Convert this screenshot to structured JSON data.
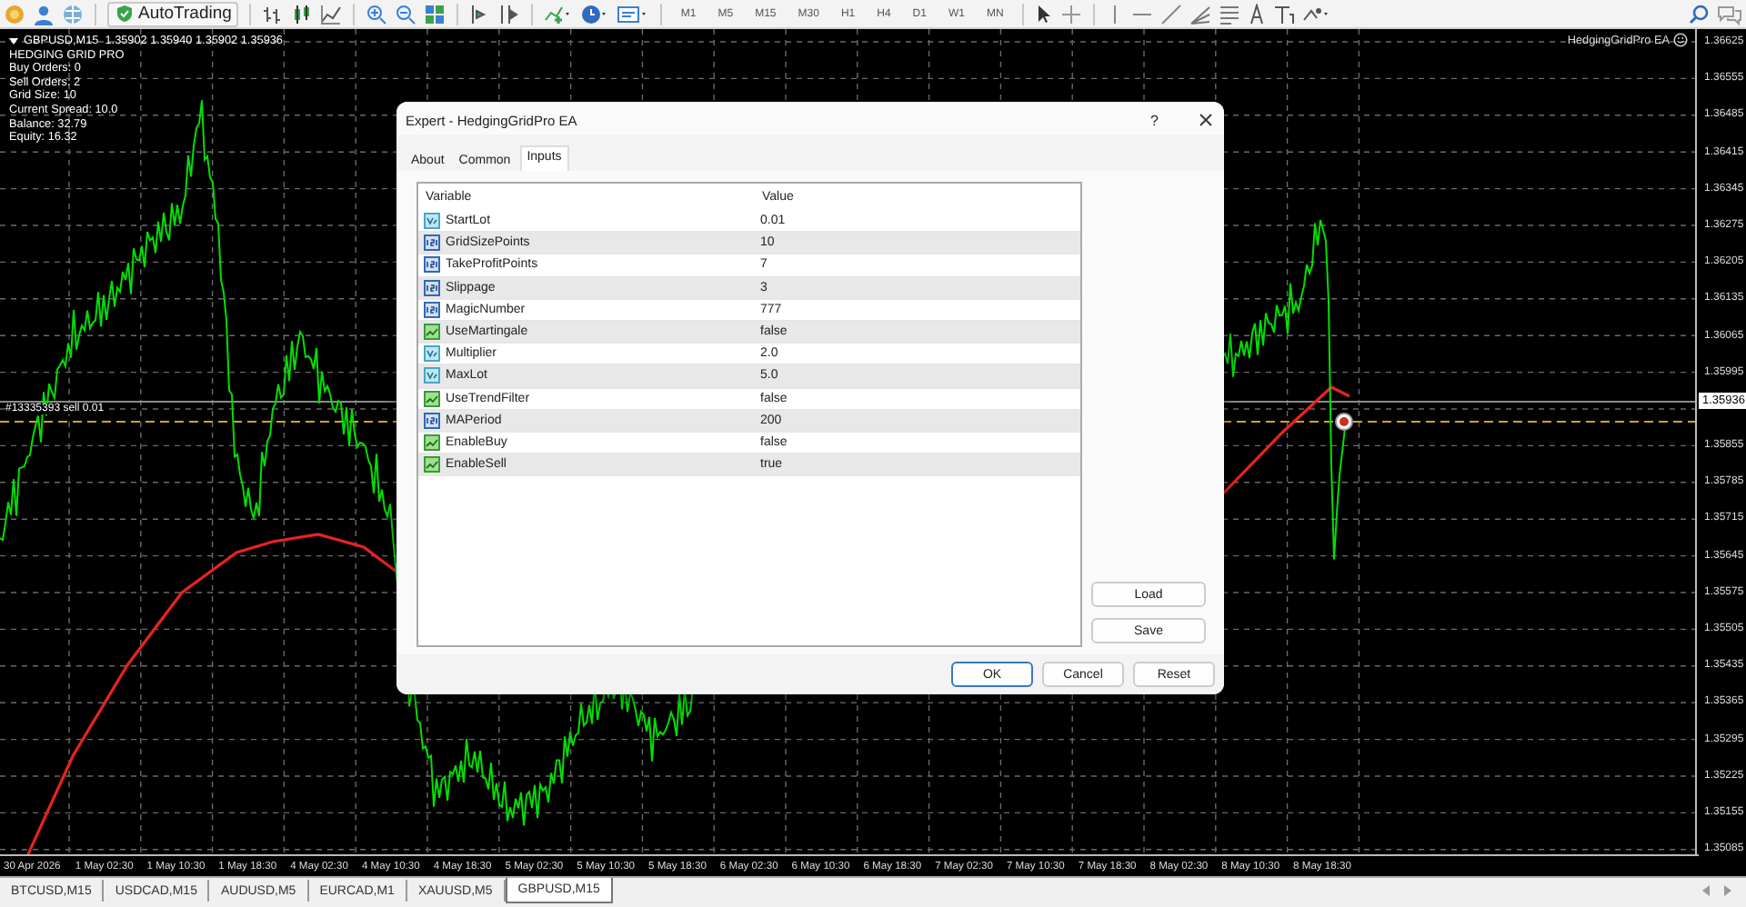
{
  "toolbar": {
    "autotrading": "AutoTrading",
    "timeframes": [
      "M1",
      "M5",
      "M15",
      "M30",
      "H1",
      "H4",
      "D1",
      "W1",
      "MN"
    ]
  },
  "chart": {
    "header": "GBPUSD,M15  1.35902 1.35940 1.35902 1.35936",
    "info_lines": [
      "HEDGING GRID PRO",
      "Buy Orders: 0",
      "Sell Orders: 2",
      "Grid Size: 10",
      "Current Spread: 10.0",
      "Balance: 32.79",
      "Equity: 16.32"
    ],
    "expert_label": "HedgingGridPro EA",
    "order_label": "#13335393 sell 0.01",
    "price_axis": [
      {
        "label": "1.36625",
        "kind": "tick"
      },
      {
        "label": "1.36555",
        "kind": "tick"
      },
      {
        "label": "1.36485",
        "kind": "tick"
      },
      {
        "label": "1.36415",
        "kind": "tick"
      },
      {
        "label": "1.36345",
        "kind": "tick"
      },
      {
        "label": "1.36275",
        "kind": "tick"
      },
      {
        "label": "1.36205",
        "kind": "tick"
      },
      {
        "label": "1.36135",
        "kind": "tick"
      },
      {
        "label": "1.36065",
        "kind": "tick"
      },
      {
        "label": "1.35995",
        "kind": "tick"
      },
      {
        "label": "1.35936",
        "kind": "current"
      },
      {
        "label": "1.35855",
        "kind": "tick"
      },
      {
        "label": "1.35785",
        "kind": "tick"
      },
      {
        "label": "1.35715",
        "kind": "tick"
      },
      {
        "label": "1.35645",
        "kind": "tick"
      },
      {
        "label": "1.35575",
        "kind": "tick"
      },
      {
        "label": "1.35505",
        "kind": "tick"
      },
      {
        "label": "1.35435",
        "kind": "tick"
      },
      {
        "label": "1.35365",
        "kind": "tick"
      },
      {
        "label": "1.35295",
        "kind": "tick"
      },
      {
        "label": "1.35225",
        "kind": "tick"
      },
      {
        "label": "1.35155",
        "kind": "tick"
      },
      {
        "label": "1.35085",
        "kind": "tick"
      }
    ],
    "time_axis": [
      "30 Apr 2026",
      "1 May 02:30",
      "1 May 10:30",
      "1 May 18:30",
      "4 May 02:30",
      "4 May 10:30",
      "4 May 18:30",
      "5 May 02:30",
      "5 May 10:30",
      "5 May 18:30",
      "6 May 02:30",
      "6 May 10:30",
      "6 May 18:30",
      "7 May 02:30",
      "7 May 10:30",
      "7 May 18:30",
      "8 May 02:30",
      "8 May 10:30",
      "8 May 18:30"
    ]
  },
  "dialog": {
    "title": "Expert - HedgingGridPro EA",
    "help": "?",
    "tabs": [
      {
        "label": "About",
        "selected": false
      },
      {
        "label": "Common",
        "selected": false
      },
      {
        "label": "Inputs",
        "selected": true
      }
    ],
    "columns": [
      "Variable",
      "Value"
    ],
    "rows": [
      {
        "variable": "StartLot",
        "value": "0.01",
        "kind": "double"
      },
      {
        "variable": "GridSizePoints",
        "value": "10",
        "kind": "int"
      },
      {
        "variable": "TakeProfitPoints",
        "value": "7",
        "kind": "int"
      },
      {
        "variable": "Slippage",
        "value": "3",
        "kind": "int"
      },
      {
        "variable": "MagicNumber",
        "value": "777",
        "kind": "int"
      },
      {
        "variable": "UseMartingale",
        "value": "false",
        "kind": "bool"
      },
      {
        "variable": "Multiplier",
        "value": "2.0",
        "kind": "double"
      },
      {
        "variable": "MaxLot",
        "value": "5.0",
        "kind": "double"
      },
      {
        "variable": "UseTrendFilter",
        "value": "false",
        "kind": "bool"
      },
      {
        "variable": "MAPeriod",
        "value": "200",
        "kind": "int"
      },
      {
        "variable": "EnableBuy",
        "value": "false",
        "kind": "bool"
      },
      {
        "variable": "EnableSell",
        "value": "true",
        "kind": "bool"
      }
    ],
    "side_buttons": [
      "Load",
      "Save"
    ],
    "buttons": [
      "OK",
      "Cancel",
      "Reset"
    ]
  },
  "symbol_tabs": [
    {
      "label": "BTCUSD,M15",
      "selected": false
    },
    {
      "label": "USDCAD,M15",
      "selected": false
    },
    {
      "label": "AUDUSD,M5",
      "selected": false
    },
    {
      "label": "EURCAD,M1",
      "selected": false
    },
    {
      "label": "XAUUSD,M5",
      "selected": false
    },
    {
      "label": "GBPUSD,M15",
      "selected": true
    }
  ]
}
